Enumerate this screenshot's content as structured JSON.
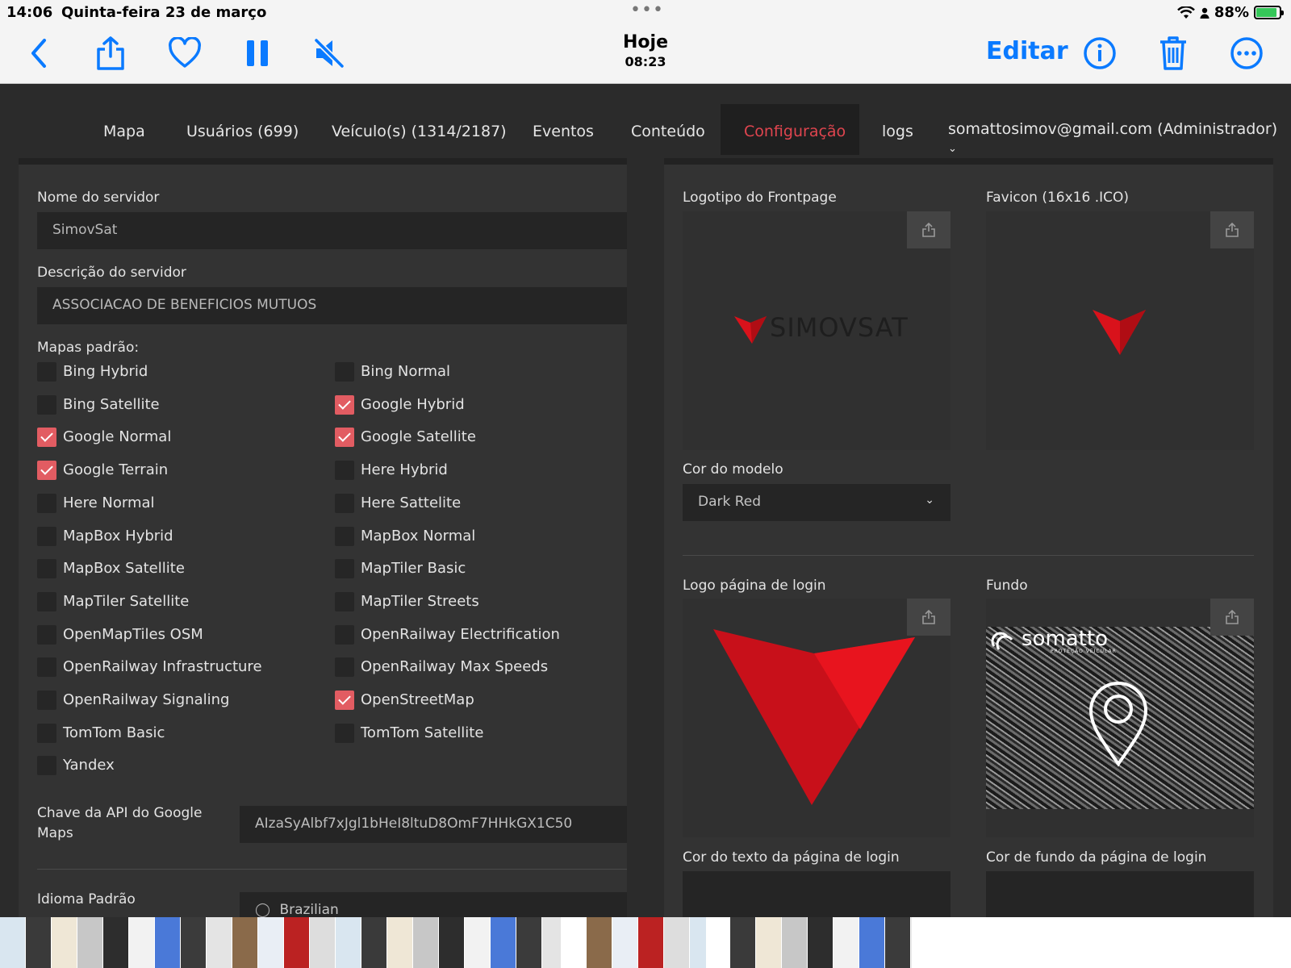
{
  "status_bar": {
    "time": "14:06",
    "date": "Quinta-feira 23 de março",
    "battery": "88%",
    "battery_level": 0.88
  },
  "photos_toolbar": {
    "title": "Hoje",
    "subtitle": "08:23",
    "edit_label": "Editar",
    "icons": [
      "back-chevron-icon",
      "share-icon",
      "heart-icon",
      "pause-icon",
      "mute-icon",
      "info-icon",
      "trash-icon",
      "more-icon"
    ]
  },
  "nav": {
    "items": [
      "Mapa",
      "Usuários (699)",
      "Veículo(s) (1314/2187)",
      "Eventos",
      "Conteúdo",
      "Configuração",
      "logs"
    ],
    "active": "Configuração",
    "user": "somattosimov@gmail.com (Administrador)"
  },
  "left": {
    "server_name_label": "Nome do servidor",
    "server_name_value": "SimovSat",
    "server_desc_label": "Descrição do servidor",
    "server_desc_value": "ASSOCIACAO DE BENEFICIOS MUTUOS",
    "maps_label": "Mapas padrão:",
    "maps": [
      {
        "label": "Bing Hybrid",
        "checked": false
      },
      {
        "label": "Bing Normal",
        "checked": false
      },
      {
        "label": "Bing Satellite",
        "checked": false
      },
      {
        "label": "Google Hybrid",
        "checked": true
      },
      {
        "label": "Google Normal",
        "checked": true
      },
      {
        "label": "Google Satellite",
        "checked": true
      },
      {
        "label": "Google Terrain",
        "checked": true
      },
      {
        "label": "Here Hybrid",
        "checked": false
      },
      {
        "label": "Here Normal",
        "checked": false
      },
      {
        "label": "Here Sattelite",
        "checked": false
      },
      {
        "label": "MapBox Hybrid",
        "checked": false
      },
      {
        "label": "MapBox Normal",
        "checked": false
      },
      {
        "label": "MapBox Satellite",
        "checked": false
      },
      {
        "label": "MapTiler Basic",
        "checked": false
      },
      {
        "label": "MapTiler Satellite",
        "checked": false
      },
      {
        "label": "MapTiler Streets",
        "checked": false
      },
      {
        "label": "OpenMapTiles OSM",
        "checked": false
      },
      {
        "label": "OpenRailway Electrification",
        "checked": false
      },
      {
        "label": "OpenRailway Infrastructure",
        "checked": false
      },
      {
        "label": "OpenRailway Max Speeds",
        "checked": false
      },
      {
        "label": "OpenRailway Signaling",
        "checked": false
      },
      {
        "label": "OpenStreetMap",
        "checked": true
      },
      {
        "label": "TomTom Basic",
        "checked": false
      },
      {
        "label": "TomTom Satellite",
        "checked": false
      },
      {
        "label": "Yandex",
        "checked": false
      }
    ],
    "api_key_label": "Chave da API do Google Maps",
    "api_key_value": "AIzaSyAlbf7xJgl1bHeI8ltuD8OmF7HHkGX1C50",
    "language_label": "Idioma Padrão",
    "language_value": "Brazilian"
  },
  "right": {
    "frontpage_logo_label": "Logotipo do Frontpage",
    "frontpage_logo_text": "SIMOVSAT",
    "favicon_label": "Favicon (16x16 .ICO)",
    "template_color_label": "Cor do modelo",
    "template_color_value": "Dark Red",
    "login_logo_label": "Logo página de login",
    "background_label": "Fundo",
    "background_brand": "somatto",
    "background_brand_tagline": "PROTEÇÃO VEICULAR",
    "login_text_color_label": "Cor do texto da página de login",
    "login_bg_color_label": "Cor de fundo da página de login"
  },
  "colors": {
    "accent_red": "#e0454f",
    "ios_blue": "#0a7aff",
    "checkbox_checked": "#e25c62",
    "logo_red": "#d9121b"
  }
}
